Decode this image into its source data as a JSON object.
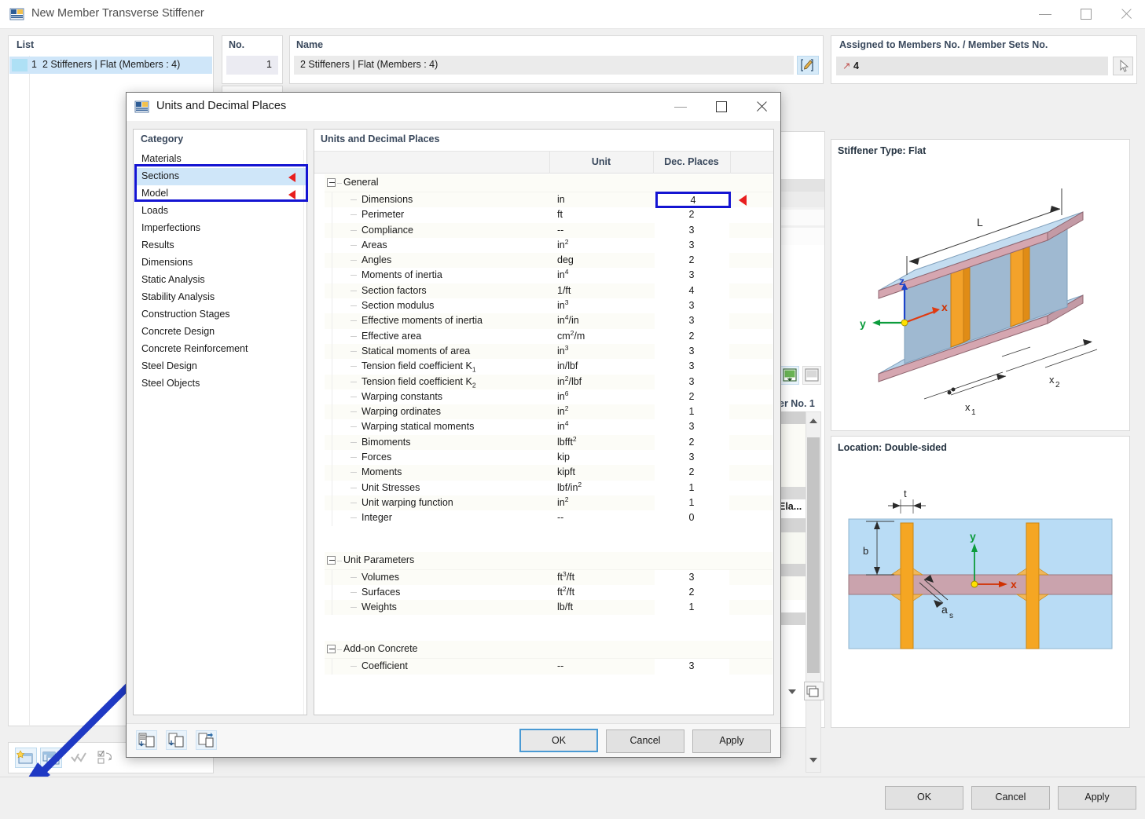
{
  "main_window": {
    "title": "New Member Transverse Stiffener",
    "icon": "member-stiffener-icon",
    "controls": {
      "minimize": "minimize-icon",
      "maximize": "maximize-icon",
      "close": "close-icon"
    },
    "list": {
      "header": "List",
      "rows": [
        {
          "no": "1",
          "text": "2 Stiffeners | Flat (Members : 4)"
        }
      ]
    },
    "no_field": {
      "header": "No.",
      "value": "1"
    },
    "name_field": {
      "header": "Name",
      "value": "2 Stiffeners | Flat (Members : 4)",
      "edit_icon": "edit-pencil-icon"
    },
    "assigned": {
      "header": "Assigned to Members No. / Member Sets No.",
      "value": "4",
      "pick_icon": "select-pointer-icon"
    },
    "preview_top": {
      "caption": "Stiffener Type: Flat",
      "labels": [
        "L",
        "x",
        "y",
        "z",
        "x₁",
        "x₂"
      ]
    },
    "preview_bottom": {
      "caption": "Location: Double-sided",
      "labels": [
        "t",
        "b",
        "x",
        "y",
        "a",
        "s"
      ]
    },
    "mid_label": "er No. 1",
    "mid_cell_text": "Ela...",
    "buttons": {
      "ok": "OK",
      "cancel": "Cancel",
      "apply": "Apply"
    },
    "toolbar_bottom_left": [
      "units-decimal-places-icon",
      "color-swatch-icon",
      "font-color-icon",
      "render-icon",
      "function-fx-icon"
    ],
    "toolbar_top_left": [
      "new-icon",
      "copy-icon",
      "check-icon",
      "options-icon"
    ]
  },
  "dialog": {
    "title": "Units and Decimal Places",
    "icon": "units-dialog-icon",
    "controls": {
      "minimize": "minimize-icon",
      "maximize": "maximize-icon",
      "close": "close-icon"
    },
    "category": {
      "header": "Category",
      "items": [
        {
          "label": "Materials",
          "selected": false,
          "flag": false
        },
        {
          "label": "Sections",
          "selected": true,
          "flag": true
        },
        {
          "label": "Model",
          "selected": false,
          "flag": true
        },
        {
          "label": "Loads",
          "selected": false,
          "flag": false
        },
        {
          "label": "Imperfections",
          "selected": false,
          "flag": false
        },
        {
          "label": "Results",
          "selected": false,
          "flag": false
        },
        {
          "label": "Dimensions",
          "selected": false,
          "flag": false
        },
        {
          "label": "Static Analysis",
          "selected": false,
          "flag": false
        },
        {
          "label": "Stability Analysis",
          "selected": false,
          "flag": false
        },
        {
          "label": "Construction Stages",
          "selected": false,
          "flag": false
        },
        {
          "label": "Concrete Design",
          "selected": false,
          "flag": false
        },
        {
          "label": "Concrete Reinforcement",
          "selected": false,
          "flag": false
        },
        {
          "label": "Steel Design",
          "selected": false,
          "flag": false
        },
        {
          "label": "Steel Objects",
          "selected": false,
          "flag": false
        }
      ]
    },
    "units_table": {
      "title": "Units and Decimal Places",
      "columns": {
        "name": "",
        "unit": "Unit",
        "dec": "Dec. Places"
      },
      "groups": [
        {
          "name": "General",
          "rows": [
            {
              "name": "Dimensions",
              "unit": "in",
              "dec": "4",
              "highlighted": true,
              "flag": true
            },
            {
              "name": "Perimeter",
              "unit": "ft",
              "dec": "2"
            },
            {
              "name": "Compliance",
              "unit": "--",
              "dec": "3"
            },
            {
              "name": "Areas",
              "unit": "in2",
              "unit_sup": "2",
              "unit_base": "in",
              "dec": "3"
            },
            {
              "name": "Angles",
              "unit": "deg",
              "dec": "2"
            },
            {
              "name": "Moments of inertia",
              "unit_base": "in",
              "unit_sup": "4",
              "dec": "3"
            },
            {
              "name": "Section factors",
              "unit": "1/ft",
              "dec": "4"
            },
            {
              "name": "Section modulus",
              "unit_base": "in",
              "unit_sup": "3",
              "dec": "3"
            },
            {
              "name": "Effective moments of inertia",
              "unit_base": "in",
              "unit_sup": "4",
              "unit_tail": "/in",
              "dec": "3"
            },
            {
              "name": "Effective area",
              "unit_base": "cm",
              "unit_sup": "2",
              "unit_tail": "/m",
              "dec": "2"
            },
            {
              "name": "Statical moments of area",
              "unit_base": "in",
              "unit_sup": "3",
              "dec": "3"
            },
            {
              "name": "Tension field coefficient K1",
              "name_base": "Tension field coefficient K",
              "name_sub": "1",
              "unit": "in/lbf",
              "dec": "3"
            },
            {
              "name": "Tension field coefficient K2",
              "name_base": "Tension field coefficient K",
              "name_sub": "2",
              "unit_base": "in",
              "unit_sup": "2",
              "unit_tail": "/lbf",
              "dec": "3"
            },
            {
              "name": "Warping constants",
              "unit_base": "in",
              "unit_sup": "6",
              "dec": "2"
            },
            {
              "name": "Warping ordinates",
              "unit_base": "in",
              "unit_sup": "2",
              "dec": "1"
            },
            {
              "name": "Warping statical moments",
              "unit_base": "in",
              "unit_sup": "4",
              "dec": "3"
            },
            {
              "name": "Bimoments",
              "unit_base": "lbfft",
              "unit_sup": "2",
              "dec": "2"
            },
            {
              "name": "Forces",
              "unit": "kip",
              "dec": "3"
            },
            {
              "name": "Moments",
              "unit": "kipft",
              "dec": "2"
            },
            {
              "name": "Unit Stresses",
              "unit_base": "lbf/in",
              "unit_sup": "2",
              "dec": "1"
            },
            {
              "name": "Unit warping function",
              "unit_base": "in",
              "unit_sup": "2",
              "dec": "1"
            },
            {
              "name": "Integer",
              "unit": "--",
              "dec": "0"
            }
          ]
        },
        {
          "name": "Unit Parameters",
          "rows": [
            {
              "name": "Volumes",
              "unit_base": "ft",
              "unit_sup": "3",
              "unit_tail": "/ft",
              "dec": "3"
            },
            {
              "name": "Surfaces",
              "unit_base": "ft",
              "unit_sup": "2",
              "unit_tail": "/ft",
              "dec": "2"
            },
            {
              "name": "Weights",
              "unit": "lb/ft",
              "dec": "1"
            }
          ]
        },
        {
          "name": "Add-on Concrete",
          "rows": [
            {
              "name": "Coefficient",
              "unit": "--",
              "dec": "3"
            }
          ]
        }
      ]
    },
    "bottom_icons": [
      "import-units-icon",
      "export-units-icon",
      "save-units-icon"
    ],
    "buttons": {
      "ok": "OK",
      "cancel": "Cancel",
      "apply": "Apply"
    }
  },
  "annotations": {
    "highlight_color": "#1414d2",
    "flag_color": "#e81e1e",
    "arrow_color": "#1f39c4"
  }
}
